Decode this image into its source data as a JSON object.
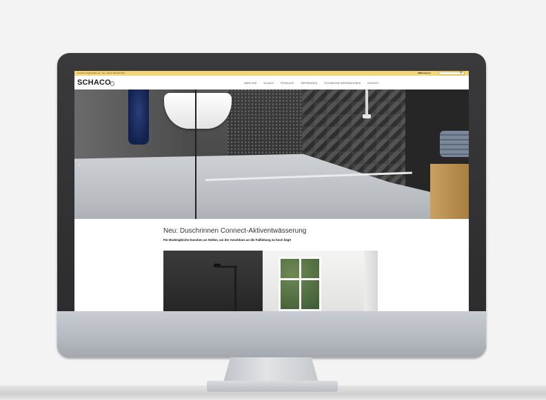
{
  "topbar": {
    "contact_text": "Kontakt: info@schaco.de · Tel. +49 (0) 000 000 000",
    "welcome_label": "Willkommen!",
    "search_placeholder": ""
  },
  "header": {
    "logo": "SCHACO",
    "nav_items": [
      "ÜBER UNS",
      "SCHACO",
      "PRODUKTE",
      "REFERENZEN",
      "TECHNISCHE INFORMATIONEN",
      "KONTAKT"
    ]
  },
  "hero": {
    "arrow_left": "‹",
    "dot_count": 6
  },
  "content": {
    "headline": "Neu: Duschrinnen Connect-Aktiventwässerung",
    "subline": "Für Bodengleiche Duschen an Stellen, wo der Anschluss an die Fallleitung zu hoch liegt!"
  },
  "colors": {
    "topbar": "#f4d67a",
    "logo": "#1b1b1b",
    "monitor_frame": "#2a2a2c",
    "chin": "#b4b8bf"
  }
}
